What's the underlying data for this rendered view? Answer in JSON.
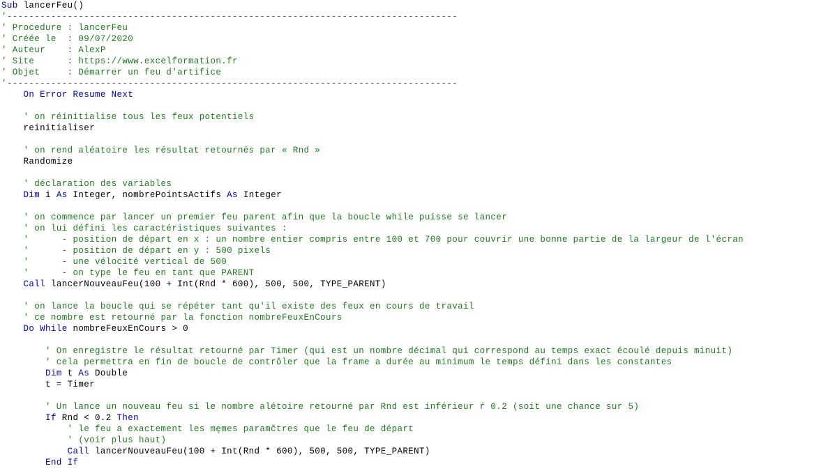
{
  "editor": {
    "name": "vba-code-editor",
    "language": "VBA",
    "background_color": "#ffffff",
    "colors": {
      "keyword": "#0000C0",
      "identifier": "#000000",
      "comment": "#1E7B1E"
    },
    "procedure_name": "lancerFeu",
    "header_block": {
      "procedure": "lancerFeu",
      "creee_le": "09/07/2020",
      "auteur": "AlexP",
      "site": "https://www.excelformation.fr",
      "objet": "Démarrer un feu d'artifice"
    },
    "lines": [
      {
        "indent": 0,
        "tokens": [
          {
            "t": "kw",
            "s": "Sub"
          },
          {
            "t": "plain",
            "s": " lancerFeu()"
          }
        ]
      },
      {
        "indent": 0,
        "tokens": [
          {
            "t": "comment",
            "s": "'----------------------------------------------------------------------------------"
          }
        ]
      },
      {
        "indent": 0,
        "tokens": [
          {
            "t": "comment",
            "s": "' Procedure : lancerFeu"
          }
        ]
      },
      {
        "indent": 0,
        "tokens": [
          {
            "t": "comment",
            "s": "' Créée le  : 09/07/2020"
          }
        ]
      },
      {
        "indent": 0,
        "tokens": [
          {
            "t": "comment",
            "s": "' Auteur    : AlexP"
          }
        ]
      },
      {
        "indent": 0,
        "tokens": [
          {
            "t": "comment",
            "s": "' Site      : https://www.excelformation.fr"
          }
        ]
      },
      {
        "indent": 0,
        "tokens": [
          {
            "t": "comment",
            "s": "' Objet     : Démarrer un feu d'artifice"
          }
        ]
      },
      {
        "indent": 0,
        "tokens": [
          {
            "t": "comment",
            "s": "'----------------------------------------------------------------------------------"
          }
        ]
      },
      {
        "indent": 0,
        "tokens": [
          {
            "t": "plain",
            "s": "    "
          },
          {
            "t": "kw",
            "s": "On Error Resume Next"
          }
        ]
      },
      {
        "indent": 0,
        "tokens": [
          {
            "t": "blank",
            "s": " "
          }
        ]
      },
      {
        "indent": 0,
        "tokens": [
          {
            "t": "comment",
            "s": "    ' on réinitialise tous les feux potentiels"
          }
        ]
      },
      {
        "indent": 0,
        "tokens": [
          {
            "t": "plain",
            "s": "    reinitialiser"
          }
        ]
      },
      {
        "indent": 0,
        "tokens": [
          {
            "t": "blank",
            "s": " "
          }
        ]
      },
      {
        "indent": 0,
        "tokens": [
          {
            "t": "comment",
            "s": "    ' on rend aléatoire les résultat retournés par « Rnd »"
          }
        ]
      },
      {
        "indent": 0,
        "tokens": [
          {
            "t": "plain",
            "s": "    Randomize"
          }
        ]
      },
      {
        "indent": 0,
        "tokens": [
          {
            "t": "blank",
            "s": " "
          }
        ]
      },
      {
        "indent": 0,
        "tokens": [
          {
            "t": "comment",
            "s": "    ' déclaration des variables"
          }
        ]
      },
      {
        "indent": 0,
        "tokens": [
          {
            "t": "plain",
            "s": "    "
          },
          {
            "t": "kw",
            "s": "Dim"
          },
          {
            "t": "plain",
            "s": " i "
          },
          {
            "t": "kw",
            "s": "As"
          },
          {
            "t": "plain",
            "s": " Integer, nombrePointsActifs "
          },
          {
            "t": "kw",
            "s": "As"
          },
          {
            "t": "plain",
            "s": " Integer"
          }
        ]
      },
      {
        "indent": 0,
        "tokens": [
          {
            "t": "blank",
            "s": " "
          }
        ]
      },
      {
        "indent": 0,
        "tokens": [
          {
            "t": "comment",
            "s": "    ' on commence par lancer un premier feu parent afin que la boucle while puisse se lancer"
          }
        ]
      },
      {
        "indent": 0,
        "tokens": [
          {
            "t": "comment",
            "s": "    ' on lui défini les caractéristiques suivantes :"
          }
        ]
      },
      {
        "indent": 0,
        "tokens": [
          {
            "t": "comment",
            "s": "    '      - position de départ en x : un nombre entier compris entre 100 et 700 pour couvrir une bonne partie de la largeur de l'écran"
          }
        ]
      },
      {
        "indent": 0,
        "tokens": [
          {
            "t": "comment",
            "s": "    '      - position de départ en y : 500 pixels"
          }
        ]
      },
      {
        "indent": 0,
        "tokens": [
          {
            "t": "comment",
            "s": "    '      - une vélocité vertical de 500"
          }
        ]
      },
      {
        "indent": 0,
        "tokens": [
          {
            "t": "comment",
            "s": "    '      - on type le feu en tant que PARENT"
          }
        ]
      },
      {
        "indent": 0,
        "tokens": [
          {
            "t": "plain",
            "s": "    "
          },
          {
            "t": "kw",
            "s": "Call"
          },
          {
            "t": "plain",
            "s": " lancerNouveauFeu(100 + Int(Rnd * 600), 500, 500, TYPE_PARENT)"
          }
        ]
      },
      {
        "indent": 0,
        "tokens": [
          {
            "t": "blank",
            "s": " "
          }
        ]
      },
      {
        "indent": 0,
        "tokens": [
          {
            "t": "comment",
            "s": "    ' on lance la boucle qui se répéter tant qu'il existe des feux en cours de travail"
          }
        ]
      },
      {
        "indent": 0,
        "tokens": [
          {
            "t": "comment",
            "s": "    ' ce nombre est retourné par la fonction nombreFeuxEnCours"
          }
        ]
      },
      {
        "indent": 0,
        "tokens": [
          {
            "t": "plain",
            "s": "    "
          },
          {
            "t": "kw",
            "s": "Do While"
          },
          {
            "t": "plain",
            "s": " nombreFeuxEnCours > 0"
          }
        ]
      },
      {
        "indent": 0,
        "tokens": [
          {
            "t": "blank",
            "s": " "
          }
        ]
      },
      {
        "indent": 0,
        "tokens": [
          {
            "t": "comment",
            "s": "        ' On enregistre le résultat retourné par Timer (qui est un nombre décimal qui correspond au temps exact écoulé depuis minuit)"
          }
        ]
      },
      {
        "indent": 0,
        "tokens": [
          {
            "t": "comment",
            "s": "        ' cela permettra en fin de boucle de contrôler que la frame a durée au minimum le temps défini dans les constantes"
          }
        ]
      },
      {
        "indent": 0,
        "tokens": [
          {
            "t": "plain",
            "s": "        "
          },
          {
            "t": "kw",
            "s": "Dim"
          },
          {
            "t": "plain",
            "s": " t "
          },
          {
            "t": "kw",
            "s": "As"
          },
          {
            "t": "plain",
            "s": " Double"
          }
        ]
      },
      {
        "indent": 0,
        "tokens": [
          {
            "t": "plain",
            "s": "        t = Timer"
          }
        ]
      },
      {
        "indent": 0,
        "tokens": [
          {
            "t": "blank",
            "s": " "
          }
        ]
      },
      {
        "indent": 0,
        "tokens": [
          {
            "t": "comment",
            "s": "        ' Un lance un nouveau feu si le nombre alétoire retourné par Rnd est inférieur ŕ 0.2 (soit une chance sur 5)"
          }
        ]
      },
      {
        "indent": 0,
        "tokens": [
          {
            "t": "plain",
            "s": "        "
          },
          {
            "t": "kw",
            "s": "If"
          },
          {
            "t": "plain",
            "s": " Rnd < 0.2 "
          },
          {
            "t": "kw",
            "s": "Then"
          }
        ]
      },
      {
        "indent": 0,
        "tokens": [
          {
            "t": "comment",
            "s": "            ' le feu a exactement les męmes paramčtres que le feu de départ"
          }
        ]
      },
      {
        "indent": 0,
        "tokens": [
          {
            "t": "comment",
            "s": "            ' (voir plus haut)"
          }
        ]
      },
      {
        "indent": 0,
        "tokens": [
          {
            "t": "plain",
            "s": "            "
          },
          {
            "t": "kw",
            "s": "Call"
          },
          {
            "t": "plain",
            "s": " lancerNouveauFeu(100 + Int(Rnd * 600), 500, 500, TYPE_PARENT)"
          }
        ]
      },
      {
        "indent": 0,
        "tokens": [
          {
            "t": "plain",
            "s": "        "
          },
          {
            "t": "kw",
            "s": "End If"
          }
        ]
      }
    ]
  }
}
